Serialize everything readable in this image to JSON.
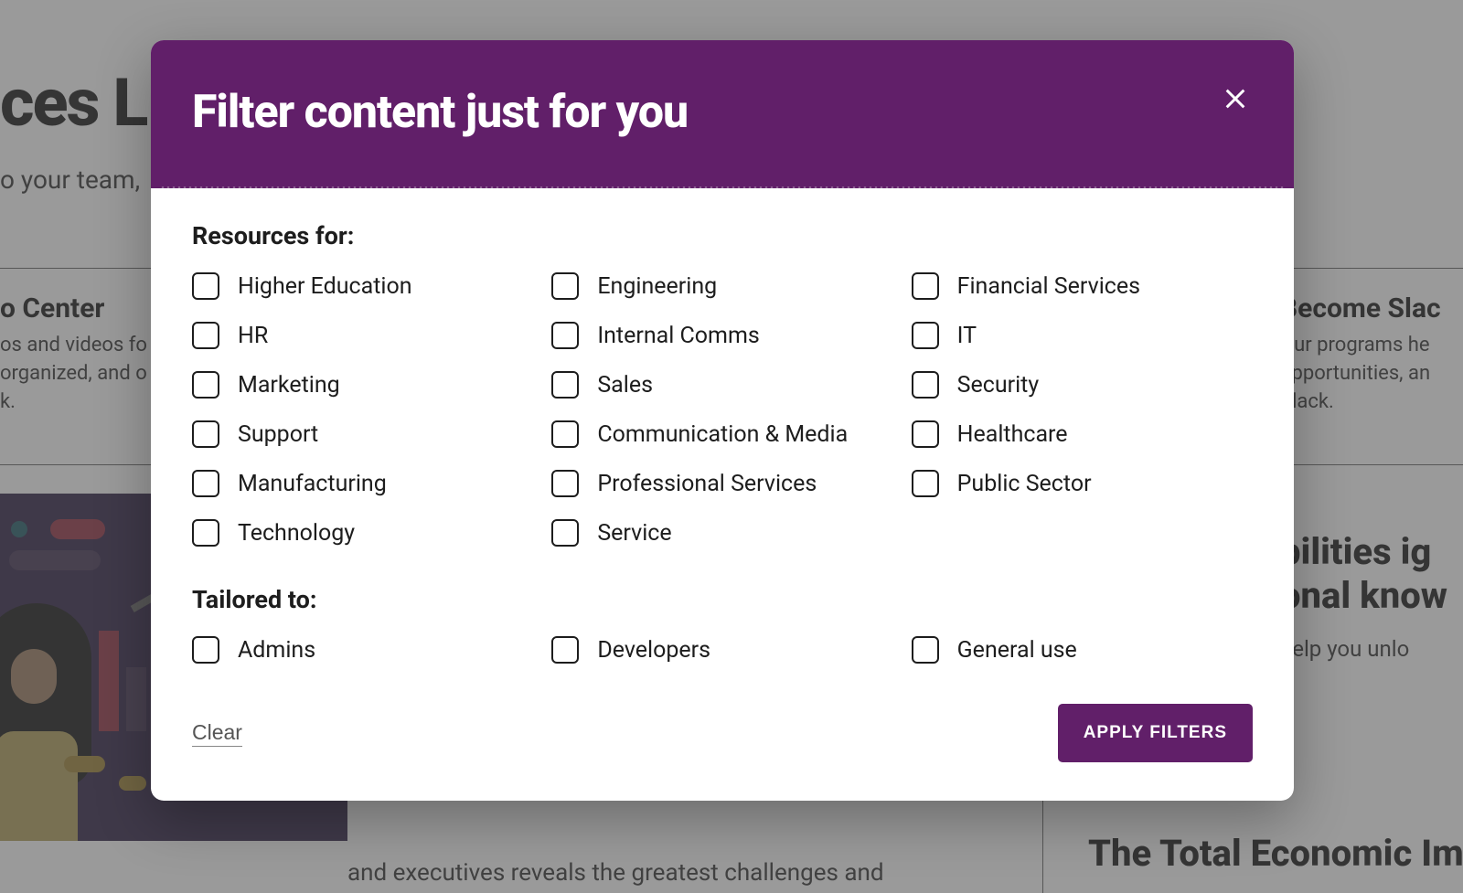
{
  "background": {
    "page_title_fragment": "ces L",
    "subtitle_fragment": "o your team,",
    "card_left": {
      "title": "o Center",
      "line1": "os and videos fo",
      "line2": "organized, and o",
      "line3": "k."
    },
    "card_right": {
      "title": "Become Slac",
      "line1": "Our programs he",
      "line2": "opportunities, an",
      "line3": "Slack."
    },
    "article_right": {
      "line1": "bilities ig",
      "line2": "onal know",
      "desc": "help you unlo"
    },
    "article_title2": "The Total Economic Im",
    "bottom_text": "and executives reveals the greatest challenges and"
  },
  "modal": {
    "title": "Filter content just for you",
    "section1_title": "Resources for:",
    "section2_title": "Tailored to:",
    "resources": [
      {
        "id": "higher-education",
        "label": "Higher Education"
      },
      {
        "id": "engineering",
        "label": "Engineering"
      },
      {
        "id": "financial-services",
        "label": "Financial Services"
      },
      {
        "id": "hr",
        "label": "HR"
      },
      {
        "id": "internal-comms",
        "label": "Internal Comms"
      },
      {
        "id": "it",
        "label": "IT"
      },
      {
        "id": "marketing",
        "label": "Marketing"
      },
      {
        "id": "sales",
        "label": "Sales"
      },
      {
        "id": "security",
        "label": "Security"
      },
      {
        "id": "support",
        "label": "Support"
      },
      {
        "id": "communication-media",
        "label": "Communication & Media"
      },
      {
        "id": "healthcare",
        "label": "Healthcare"
      },
      {
        "id": "manufacturing",
        "label": "Manufacturing"
      },
      {
        "id": "professional-services",
        "label": "Professional Services"
      },
      {
        "id": "public-sector",
        "label": "Public Sector"
      },
      {
        "id": "technology",
        "label": "Technology"
      },
      {
        "id": "service",
        "label": "Service"
      }
    ],
    "tailored": [
      {
        "id": "admins",
        "label": "Admins"
      },
      {
        "id": "developers",
        "label": "Developers"
      },
      {
        "id": "general-use",
        "label": "General use"
      }
    ],
    "clear_label": "Clear",
    "apply_label": "APPLY FILTERS"
  }
}
